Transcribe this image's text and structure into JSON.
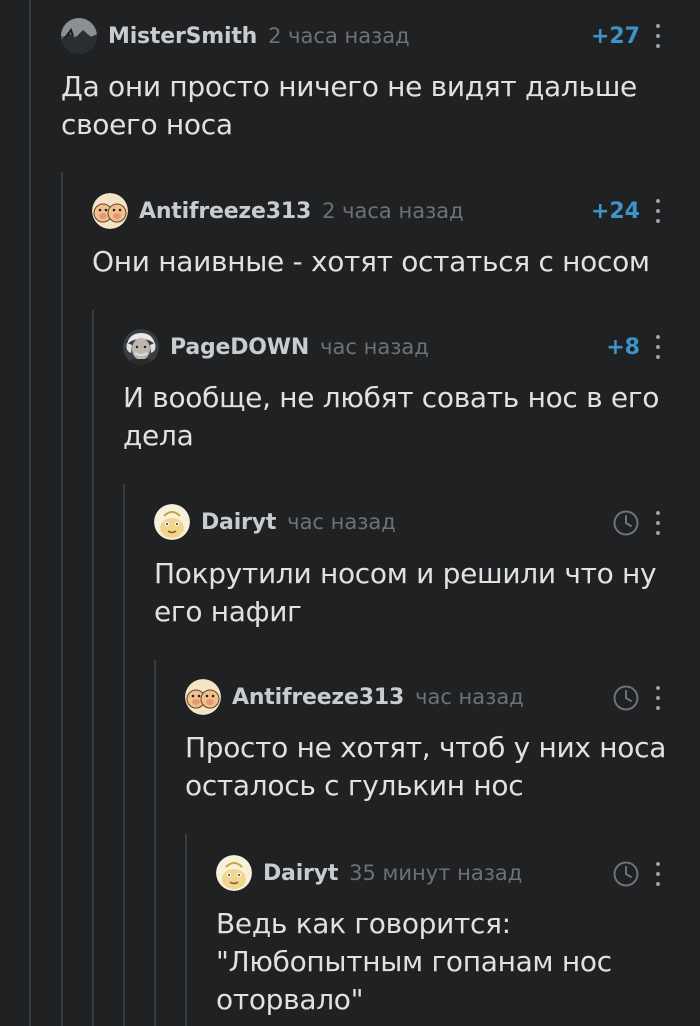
{
  "comments": [
    {
      "username": "MisterSmith",
      "timestamp": "2 часа назад",
      "rating": "+27",
      "avatar_icon": "night-landscape-avatar",
      "text_lines": [
        "Да они просто ничего не видят дальше",
        "своего носа"
      ]
    },
    {
      "username": "Antifreeze313",
      "timestamp": "2 часа назад",
      "rating": "+24",
      "avatar_icon": "pig-faces-avatar",
      "text_lines": [
        "Они наивные - хотят остаться с носом"
      ]
    },
    {
      "username": "PageDOWN",
      "timestamp": "час назад",
      "rating": "+8",
      "avatar_icon": "einstein-avatar",
      "text_lines": [
        "И вообще, не любят совать нос в его",
        "дела"
      ]
    },
    {
      "username": "Dairyt",
      "timestamp": "час назад",
      "rating_icon": "clock-icon",
      "avatar_icon": "cartoon-face-avatar",
      "text_lines": [
        "Покрутили носом и решили что ну",
        "его нафиг"
      ]
    },
    {
      "username": "Antifreeze313",
      "timestamp": "час назад",
      "rating_icon": "clock-icon",
      "avatar_icon": "pig-faces-avatar",
      "text_lines": [
        "Просто не хотят, чтоб у них носа",
        "осталось с гулькин нос"
      ]
    },
    {
      "username": "Dairyt",
      "timestamp": "35 минут назад",
      "rating_icon": "clock-icon",
      "avatar_icon": "cartoon-face-avatar",
      "text_lines": [
        "Ведь как говорится:",
        "\"Любопытным гопанам нос",
        "оторвало\""
      ]
    }
  ],
  "colors": {
    "background": "#1f2123",
    "thread_line": "#3a3d40",
    "username": "#c9ccce",
    "timestamp": "#6e7275",
    "rating": "#3d94c8",
    "body_text": "#dfe1e3"
  }
}
